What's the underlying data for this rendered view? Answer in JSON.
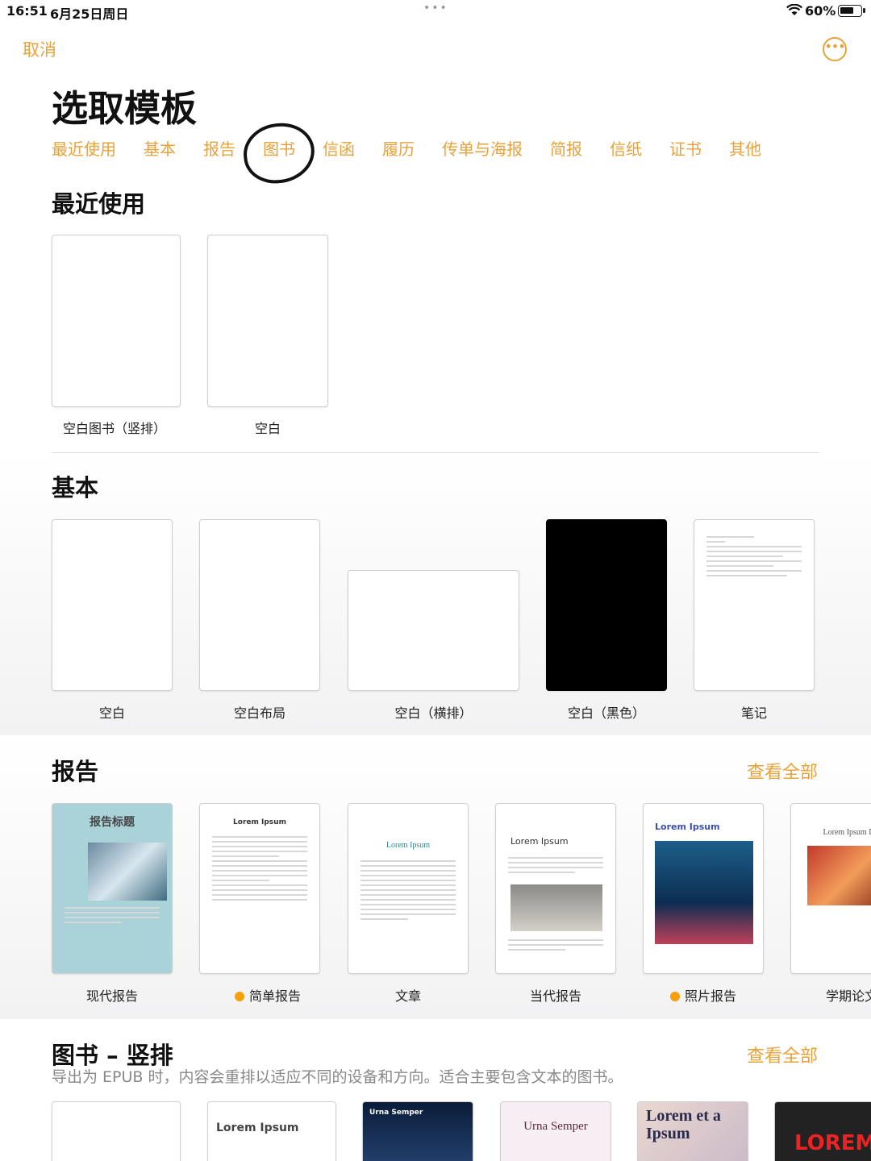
{
  "status": {
    "time": "16:51",
    "date": "6月25日周日",
    "dots": "•••",
    "battery": "60%"
  },
  "header": {
    "cancel": "取消",
    "more_icon": "ellipsis-circle-icon",
    "title": "选取模板"
  },
  "tabs": [
    "最近使用",
    "基本",
    "报告",
    "图书",
    "信函",
    "履历",
    "传单与海报",
    "简报",
    "信纸",
    "证书",
    "其他"
  ],
  "recent": {
    "title": "最近使用",
    "items": [
      "空白图书（竖排）",
      "空白"
    ]
  },
  "basic": {
    "title": "基本",
    "items": [
      "空白",
      "空白布局",
      "空白（横排）",
      "空白（黑色）",
      "笔记"
    ]
  },
  "reports": {
    "title": "报告",
    "see_all": "查看全部",
    "items": [
      "现代报告",
      "简单报告",
      "文章",
      "当代报告",
      "照片报告",
      "学期论文"
    ],
    "thumb_texts": {
      "modern": "报告标题",
      "simple": "Lorem Ipsum",
      "essay": "Lorem Ipsum",
      "contemporary": "Lorem Ipsum",
      "photo": "Lorem Ipsum",
      "term": "Lorem Ipsum Do"
    }
  },
  "books": {
    "title": "图书 – 竖排",
    "see_all": "查看全部",
    "description": "导出为 EPUB 时，内容会重排以适应不同的设备和方向。适合主要包含文本的图书。",
    "thumb_texts": [
      "Lorem Ipsum",
      "Urna Semper",
      "Urna Semper",
      "Lorem et a Ipsum",
      "LOREM"
    ]
  }
}
